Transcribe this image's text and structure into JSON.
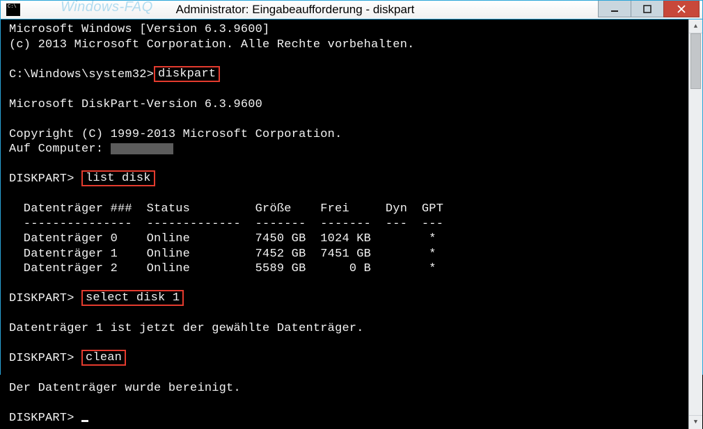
{
  "titlebar": {
    "watermark": "Windows-FAQ",
    "title": "Administrator: Eingabeaufforderung - diskpart"
  },
  "terminal": {
    "line1": "Microsoft Windows [Version 6.3.9600]",
    "line2": "(c) 2013 Microsoft Corporation. Alle Rechte vorbehalten.",
    "prompt_sys": "C:\\Windows\\system32>",
    "cmd_diskpart": "diskpart",
    "blank": " ",
    "dp_version": "Microsoft DiskPart-Version 6.3.9600",
    "dp_copyright": "Copyright (C) 1999-2013 Microsoft Corporation.",
    "on_computer": "Auf Computer: ",
    "prompt_dp": "DISKPART> ",
    "cmd_listdisk": "list disk",
    "tbl_header": "  Datenträger ###  Status         Größe    Frei     Dyn  GPT",
    "tbl_divider": "  ---------------  -------------  -------  -------  ---  ---",
    "tbl_row0": "  Datenträger 0    Online         7450 GB  1024 KB        *",
    "tbl_row1": "  Datenträger 1    Online         7452 GB  7451 GB        *",
    "tbl_row2": "  Datenträger 2    Online         5589 GB      0 B        *",
    "cmd_select": "select disk 1",
    "select_confirm": "Datenträger 1 ist jetzt der gewählte Datenträger.",
    "cmd_clean": "clean",
    "clean_confirm": "Der Datenträger wurde bereinigt."
  }
}
